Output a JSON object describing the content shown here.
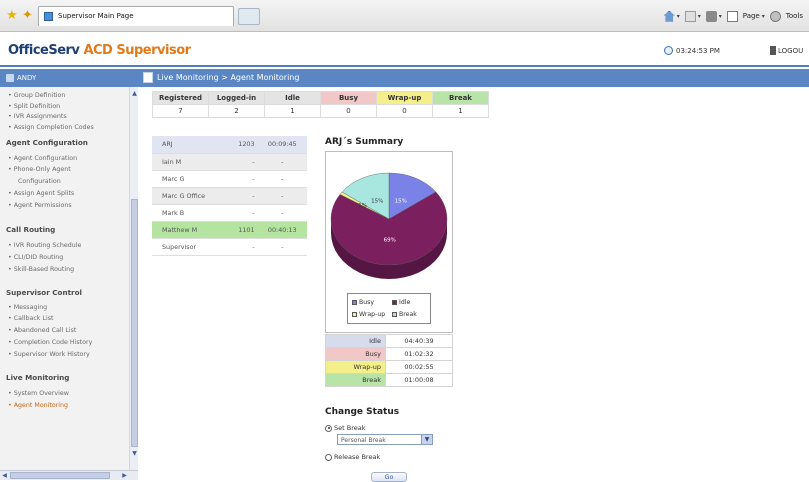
{
  "browser": {
    "tab_title": "Supervisor Main Page",
    "page_label": "Page",
    "tools_label": "Tools"
  },
  "header": {
    "logo_main": "OfficeServ",
    "logo_accent": "ACD Supervisor",
    "clock": "03:24:53 PM",
    "logout": "LOGOU"
  },
  "titlebar": {
    "user": "ANDY",
    "breadcrumb": "Live Monitoring > Agent Monitoring"
  },
  "sidebar": {
    "items": [
      {
        "label": "• Group Definition",
        "type": "item"
      },
      {
        "label": "• Split Definition",
        "type": "item"
      },
      {
        "label": "• IVR Assignments",
        "type": "item"
      },
      {
        "label": "• Assign Completion Codes",
        "type": "item"
      },
      {
        "label": "Agent Configuration",
        "type": "head"
      },
      {
        "label": "• Agent Configuration",
        "type": "item"
      },
      {
        "label": "• Phone-Only Agent",
        "type": "item"
      },
      {
        "label": "Configuration",
        "type": "item"
      },
      {
        "label": "• Assign Agent Splits",
        "type": "item"
      },
      {
        "label": "• Agent Permissions",
        "type": "item"
      },
      {
        "label": "Call Routing",
        "type": "head"
      },
      {
        "label": "• IVR Routing Schedule",
        "type": "item"
      },
      {
        "label": "• CLI/DID Routing",
        "type": "item"
      },
      {
        "label": "• Skill-Based Routing",
        "type": "item"
      },
      {
        "label": "Supervisor Control",
        "type": "head"
      },
      {
        "label": "• Messaging",
        "type": "item"
      },
      {
        "label": "• Callback List",
        "type": "item"
      },
      {
        "label": "• Abandoned Call List",
        "type": "item"
      },
      {
        "label": "• Completion Code History",
        "type": "item"
      },
      {
        "label": "• Supervisor Work History",
        "type": "item"
      },
      {
        "label": "Live Monitoring",
        "type": "head"
      },
      {
        "label": "• System Overview",
        "type": "item"
      },
      {
        "label": "• Agent Monitoring",
        "type": "active"
      }
    ]
  },
  "stats": {
    "headers": [
      "Registered",
      "Logged-in",
      "Idle",
      "Busy",
      "Wrap-up",
      "Break"
    ],
    "values": [
      "7",
      "2",
      "1",
      "0",
      "0",
      "1"
    ]
  },
  "agents": [
    {
      "name": "ARJ",
      "ext": "1203",
      "time": "00:09:45",
      "style": "sel"
    },
    {
      "name": "Iain M",
      "ext": "-",
      "time": "-",
      "style": "gray"
    },
    {
      "name": "Marc G",
      "ext": "-",
      "time": "-",
      "style": ""
    },
    {
      "name": "Marc G Office",
      "ext": "-",
      "time": "-",
      "style": "gray"
    },
    {
      "name": "Mark B",
      "ext": "-",
      "time": "-",
      "style": ""
    },
    {
      "name": "Matthew M",
      "ext": "1101",
      "time": "00:40:13",
      "style": "green"
    },
    {
      "name": "Supervisor",
      "ext": "-",
      "time": "-",
      "style": ""
    }
  ],
  "summary": {
    "title": "ARJ´s Summary",
    "slices": [
      {
        "label": "Idle",
        "value": 69,
        "color": "#7b1f5f"
      },
      {
        "label": "Busy",
        "value": 15,
        "color": "#7a82e8"
      },
      {
        "label": "Wrap-up",
        "value": 1,
        "color": "#f4ef8a"
      },
      {
        "label": "Break",
        "value": 15,
        "color": "#a8e6e0"
      }
    ],
    "slice_labels": [
      "15%",
      "15%",
      "1%",
      "69%"
    ],
    "legend": [
      "Busy",
      "Idle",
      "Wrap-up",
      "Break"
    ],
    "times": [
      {
        "label": "Idle",
        "value": "04:40:39",
        "style": "idle"
      },
      {
        "label": "Busy",
        "value": "01:02:32",
        "style": "busy"
      },
      {
        "label": "Wrap-up",
        "value": "00:02:55",
        "style": "wrap"
      },
      {
        "label": "Break",
        "value": "01:00:08",
        "style": "brk"
      }
    ]
  },
  "change_status": {
    "title": "Change Status",
    "set_break": "Set Break",
    "break_reason": "Personal Break",
    "release_break": "Release Break",
    "go": "Go"
  }
}
